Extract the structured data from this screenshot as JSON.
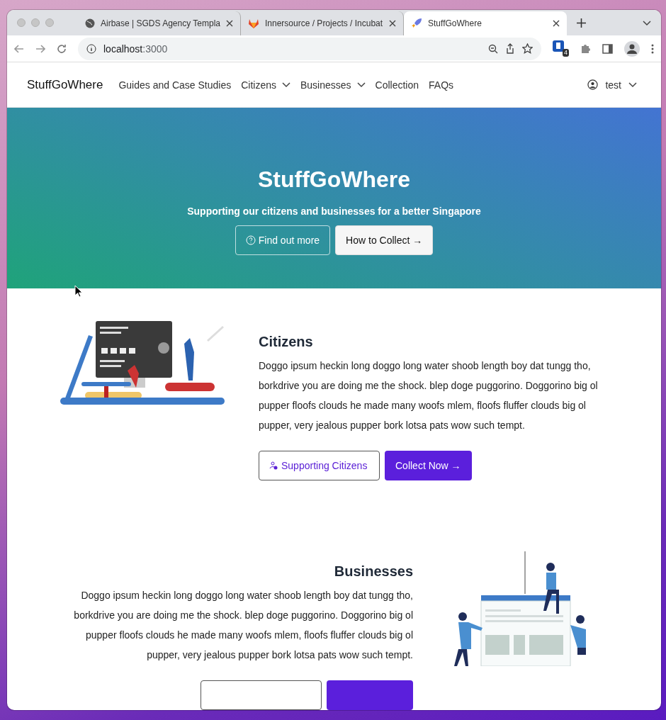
{
  "browser": {
    "tabs": [
      {
        "title": "Airbase | SGDS Agency Templa",
        "selected": false
      },
      {
        "title": "Innersource / Projects / Incubat",
        "selected": false
      },
      {
        "title": "StuffGoWhere",
        "selected": true
      }
    ],
    "url_host": "localhost",
    "url_port": ":3000",
    "extension_badge": "4"
  },
  "navbar": {
    "brand": "StuffGoWhere",
    "items": [
      {
        "label": "Guides and Case Studies",
        "dropdown": false
      },
      {
        "label": "Citizens",
        "dropdown": true
      },
      {
        "label": "Businesses",
        "dropdown": true
      },
      {
        "label": "Collection",
        "dropdown": false
      },
      {
        "label": "FAQs",
        "dropdown": false
      }
    ],
    "user": "test"
  },
  "hero": {
    "title": "StuffGoWhere",
    "subtitle": "Supporting our citizens and businesses for a better Singapore",
    "buttons": [
      {
        "label": "Find out more",
        "kind": "outline"
      },
      {
        "label": "How to Collect →",
        "kind": "light"
      }
    ]
  },
  "sections": [
    {
      "kind": "image-left",
      "title": "Citizens",
      "body": "Doggo ipsum heckin long doggo long water shoob length boy dat tungg tho, borkdrive you are doing me the shock. blep doge puggorino. Doggorino big ol pupper floofs clouds he made many woofs mlem, floofs fluffer clouds big ol pupper, very jealous pupper bork lotsa pats wow such tempt.",
      "secondary": "Supporting Citizens",
      "primary": "Collect Now →"
    },
    {
      "kind": "image-right",
      "title": "Businesses",
      "body": "Doggo ipsum heckin long doggo long water shoob length boy dat tungg tho, borkdrive you are doing me the shock. blep doge puggorino. Doggorino big ol pupper floofs clouds he made many woofs mlem, floofs fluffer clouds big ol pupper, very jealous pupper bork lotsa pats wow such tempt."
    }
  ]
}
